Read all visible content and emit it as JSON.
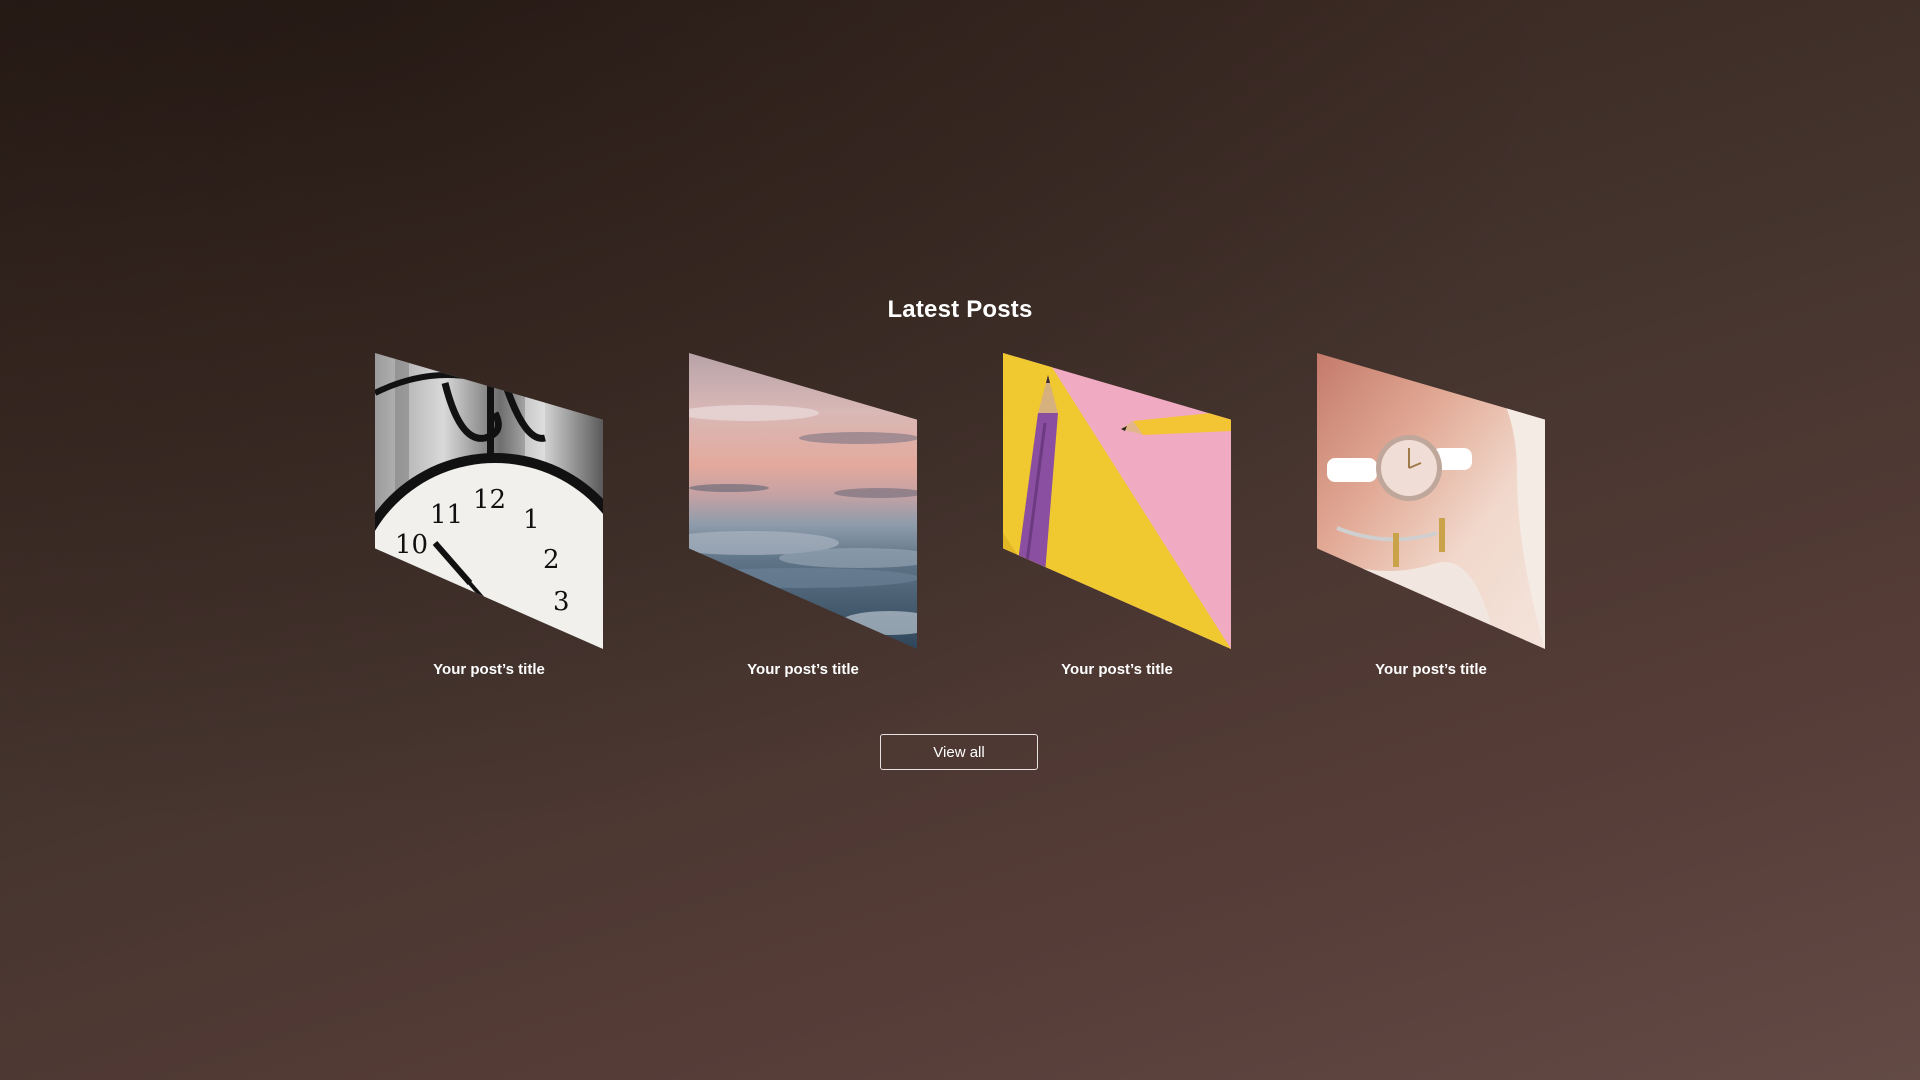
{
  "section": {
    "title": "Latest Posts"
  },
  "posts": [
    {
      "title": "Your post’s title",
      "image": "clock-photo"
    },
    {
      "title": "Your post’s title",
      "image": "clouds-sunset-photo"
    },
    {
      "title": "Your post’s title",
      "image": "pencils-photo"
    },
    {
      "title": "Your post’s title",
      "image": "wristwatch-photo"
    }
  ],
  "view_all": {
    "label": "View all"
  },
  "colors": {
    "background_start": "#2b1e19",
    "background_end": "#634a45",
    "text": "#ffffff",
    "button_border": "#e8e3e1"
  }
}
